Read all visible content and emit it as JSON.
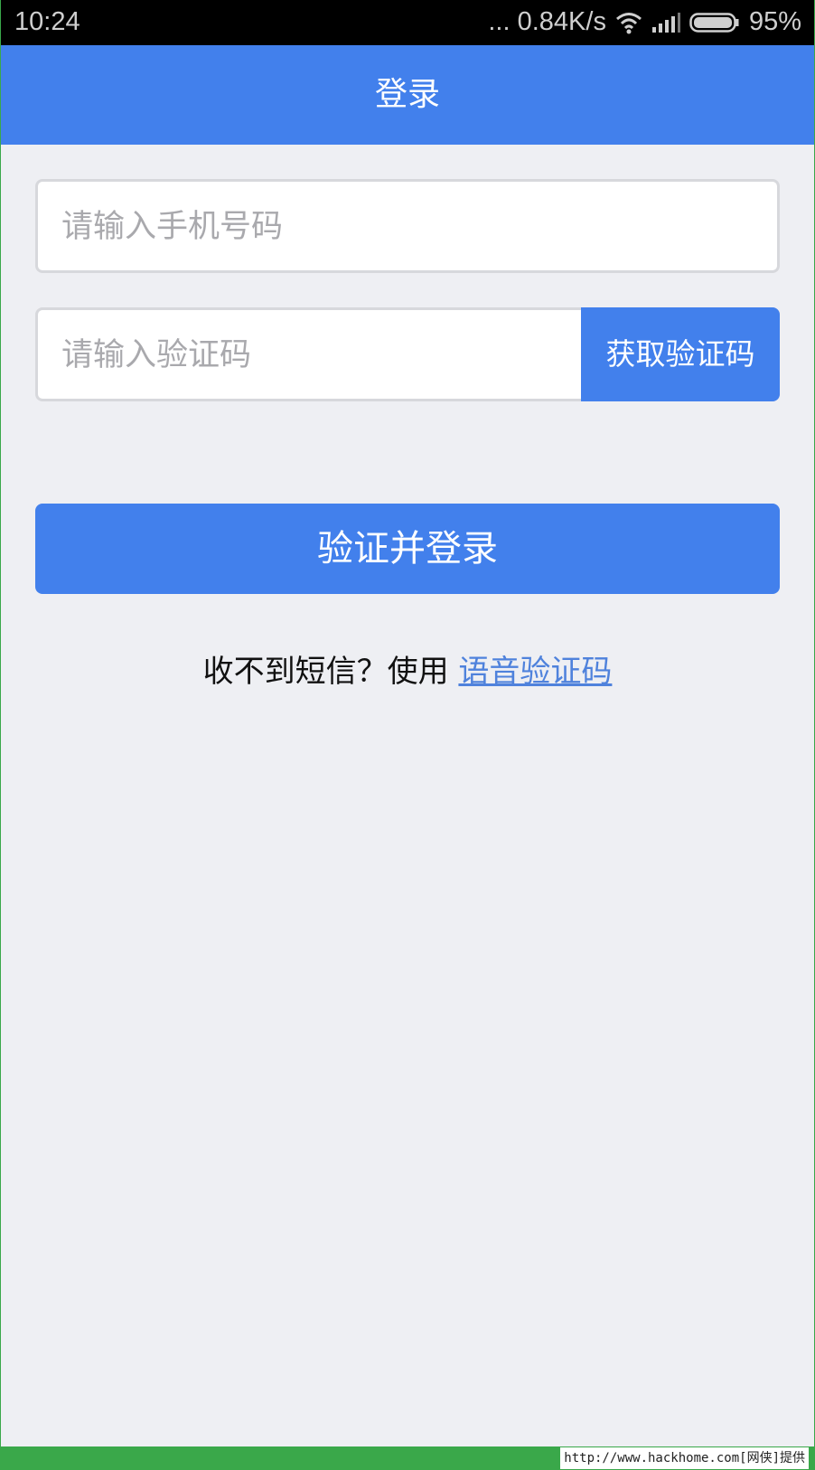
{
  "status_bar": {
    "time": "10:24",
    "network_speed": "... 0.84K/s",
    "battery": "95%",
    "icons": [
      "wifi-icon",
      "signal-icon",
      "battery-icon"
    ]
  },
  "header": {
    "title": "登录"
  },
  "form": {
    "phone_placeholder": "请输入手机号码",
    "phone_value": "",
    "code_placeholder": "请输入验证码",
    "code_value": "",
    "get_code_label": "获取验证码",
    "submit_label": "验证并登录"
  },
  "voice": {
    "prompt": "收不到短信？使用 ",
    "link_label": "语音验证码"
  },
  "watermark": {
    "text": "http://www.hackhome.com[网侠]提供"
  },
  "colors": {
    "accent": "#4280ec",
    "background": "#eeeff3",
    "link": "#4f82dc",
    "watermark_bar": "#3aa84a"
  }
}
